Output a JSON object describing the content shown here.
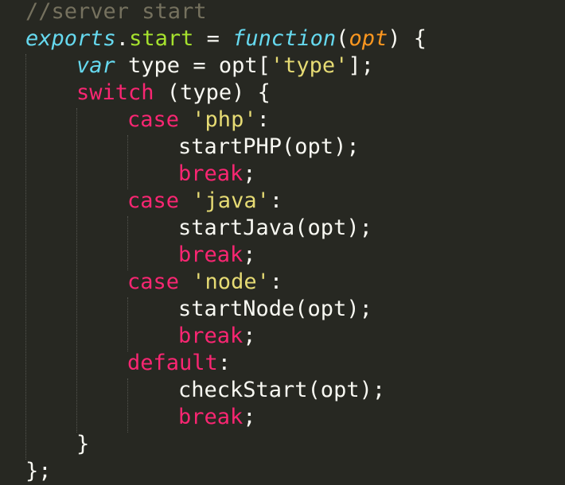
{
  "editor": {
    "theme_colors": {
      "background": "#272822",
      "foreground": "#f8f8f2",
      "comment": "#75715e",
      "storage": "#66d9ef",
      "function_name": "#a6e22e",
      "parameter": "#fd971f",
      "keyword": "#f92672",
      "string": "#e6db74",
      "indent_guide": "#555650"
    },
    "lines": [
      {
        "tokens": [
          {
            "text": "//server start",
            "type": "comment"
          }
        ]
      },
      {
        "tokens": [
          {
            "text": "exports",
            "type": "storage"
          },
          {
            "text": ".",
            "type": "plain"
          },
          {
            "text": "start",
            "type": "func"
          },
          {
            "text": " = ",
            "type": "plain"
          },
          {
            "text": "function",
            "type": "storage"
          },
          {
            "text": "(",
            "type": "plain"
          },
          {
            "text": "opt",
            "type": "param"
          },
          {
            "text": ") {",
            "type": "plain"
          }
        ]
      },
      {
        "tokens": [
          {
            "text": "var",
            "type": "storage"
          },
          {
            "text": " type = opt[",
            "type": "plain"
          },
          {
            "text": "'type'",
            "type": "string"
          },
          {
            "text": "];",
            "type": "plain"
          }
        ]
      },
      {
        "tokens": [
          {
            "text": "switch",
            "type": "keyword"
          },
          {
            "text": " (type) {",
            "type": "plain"
          }
        ]
      },
      {
        "tokens": [
          {
            "text": "case",
            "type": "keyword"
          },
          {
            "text": " ",
            "type": "plain"
          },
          {
            "text": "'php'",
            "type": "string"
          },
          {
            "text": ":",
            "type": "plain"
          }
        ]
      },
      {
        "tokens": [
          {
            "text": "startPHP(opt);",
            "type": "plain"
          }
        ]
      },
      {
        "tokens": [
          {
            "text": "break",
            "type": "keyword"
          },
          {
            "text": ";",
            "type": "plain"
          }
        ]
      },
      {
        "tokens": [
          {
            "text": "case",
            "type": "keyword"
          },
          {
            "text": " ",
            "type": "plain"
          },
          {
            "text": "'java'",
            "type": "string"
          },
          {
            "text": ":",
            "type": "plain"
          }
        ]
      },
      {
        "tokens": [
          {
            "text": "startJava(opt);",
            "type": "plain"
          }
        ]
      },
      {
        "tokens": [
          {
            "text": "break",
            "type": "keyword"
          },
          {
            "text": ";",
            "type": "plain"
          }
        ]
      },
      {
        "tokens": [
          {
            "text": "case",
            "type": "keyword"
          },
          {
            "text": " ",
            "type": "plain"
          },
          {
            "text": "'node'",
            "type": "string"
          },
          {
            "text": ":",
            "type": "plain"
          }
        ]
      },
      {
        "tokens": [
          {
            "text": "startNode(opt);",
            "type": "plain"
          }
        ]
      },
      {
        "tokens": [
          {
            "text": "break",
            "type": "keyword"
          },
          {
            "text": ";",
            "type": "plain"
          }
        ]
      },
      {
        "tokens": [
          {
            "text": "default",
            "type": "keyword"
          },
          {
            "text": ":",
            "type": "plain"
          }
        ]
      },
      {
        "tokens": [
          {
            "text": "checkStart(opt);",
            "type": "plain"
          }
        ]
      },
      {
        "tokens": [
          {
            "text": "break",
            "type": "keyword"
          },
          {
            "text": ";",
            "type": "plain"
          }
        ]
      },
      {
        "tokens": [
          {
            "text": "}",
            "type": "plain"
          }
        ]
      },
      {
        "tokens": [
          {
            "text": "};",
            "type": "plain"
          }
        ]
      }
    ]
  }
}
